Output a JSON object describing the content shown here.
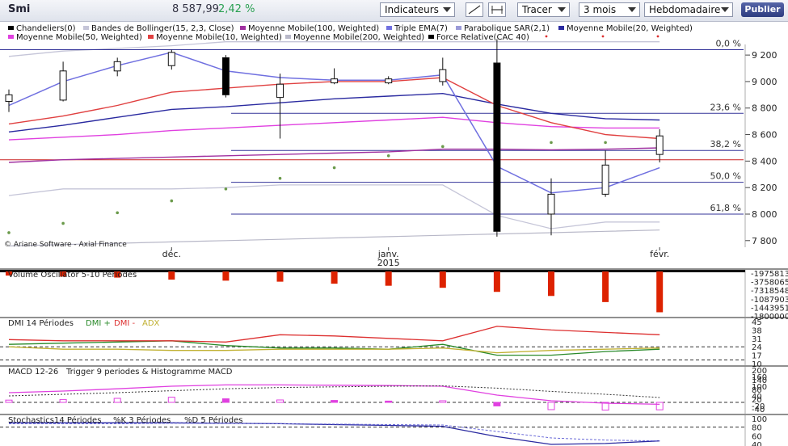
{
  "toolbar": {
    "symbol": "Smi",
    "price": "8 587,99",
    "change": "2,42 %",
    "indicators_label": "Indicateurs",
    "draw_label": "Tracer",
    "period_label": "3 mois",
    "interval_label": "Hebdomadaire",
    "publish_label": "Publier"
  },
  "colors": {
    "candle": "#000000",
    "bollinger": "#c5c5d8",
    "mm100": "#a030a0",
    "tema": "#7070e0",
    "sar": "#6a9a4a",
    "mm20": "#2a2aa0",
    "mm50": "#e040e0",
    "mm10": "#e04040",
    "mm200": "#b8b8c8",
    "force": "#000000",
    "volume": "#dd2200",
    "dmi_plus": "#2a8a2a",
    "dmi_minus": "#dd3030",
    "adx": "#c0b030",
    "macd": "#e040e0",
    "trigger": "#333333",
    "fib": "#333399",
    "hline": "#cc2222"
  },
  "legend": [
    {
      "label": "Chandeliers(0)",
      "color": "#000000"
    },
    {
      "label": "Bandes de Bollinger(15, 2,3, Close)",
      "color": "#c5c5d8"
    },
    {
      "label": "Moyenne Mobile(100, Weighted)",
      "color": "#a030a0"
    },
    {
      "label": "Triple EMA(7)",
      "color": "#7070e0"
    },
    {
      "label": "Parabolique SAR(2,1)",
      "color": "#9a9ad8"
    },
    {
      "label": "Moyenne Mobile(20, Weighted)",
      "color": "#2a2aa0"
    },
    {
      "label": "Moyenne Mobile(50, Weighted)",
      "color": "#e040e0"
    },
    {
      "label": "Moyenne Mobile(10, Weighted)",
      "color": "#e04040"
    },
    {
      "label": "Moyenne Mobile(200, Weighted)",
      "color": "#b8b8c8"
    },
    {
      "label": "Force Relative(CAC 40)",
      "color": "#000000"
    }
  ],
  "watermark": "© Ariane Software - Axial Finance",
  "chart_data": [
    {
      "type": "candlestick",
      "name": "price",
      "x_labels": [
        {
          "label": "déc.",
          "index": 3
        },
        {
          "label": "janv.",
          "sub": "2015",
          "index": 7
        },
        {
          "label": "févr.",
          "index": 12
        }
      ],
      "ylim": [
        7750,
        9280
      ],
      "yticks": [
        9200,
        9000,
        8800,
        8600,
        8400,
        8200,
        8000,
        7800
      ],
      "ytick_labels": [
        "9 200",
        "9 000",
        "8 800",
        "8 600",
        "8 400",
        "8 200",
        "8 000",
        "7 800"
      ],
      "candles": [
        {
          "o": 8850,
          "h": 8940,
          "l": 8770,
          "c": 8900
        },
        {
          "o": 8860,
          "h": 9150,
          "l": 8850,
          "c": 9080
        },
        {
          "o": 9080,
          "h": 9180,
          "l": 9040,
          "c": 9150
        },
        {
          "o": 9120,
          "h": 9240,
          "l": 9090,
          "c": 9220
        },
        {
          "o": 9180,
          "h": 9200,
          "l": 8880,
          "c": 8900
        },
        {
          "o": 8880,
          "h": 9060,
          "l": 8570,
          "c": 8980
        },
        {
          "o": 8990,
          "h": 9100,
          "l": 8980,
          "c": 9020
        },
        {
          "o": 8990,
          "h": 9040,
          "l": 8980,
          "c": 9020
        },
        {
          "o": 9000,
          "h": 9180,
          "l": 8970,
          "c": 9090
        },
        {
          "o": 9140,
          "h": 9320,
          "l": 7830,
          "c": 7870
        },
        {
          "o": 8000,
          "h": 8270,
          "l": 7840,
          "c": 8150
        },
        {
          "o": 8150,
          "h": 8480,
          "l": 8130,
          "c": 8370
        },
        {
          "o": 8450,
          "h": 8640,
          "l": 8390,
          "c": 8590
        }
      ],
      "series": [
        {
          "key": "boll_upper",
          "values": [
            9190,
            9230,
            9250,
            9270,
            9300,
            9300,
            9300,
            9300,
            9300,
            9300,
            9300,
            9300,
            9300
          ]
        },
        {
          "key": "boll_lower",
          "values": [
            8140,
            8190,
            8190,
            8190,
            8200,
            8220,
            8220,
            8220,
            8220,
            7990,
            7890,
            7940,
            7940
          ]
        },
        {
          "key": "mm10",
          "values": [
            8680,
            8740,
            8820,
            8920,
            8950,
            8980,
            9000,
            9000,
            9030,
            8820,
            8690,
            8600,
            8570
          ]
        },
        {
          "key": "mm20",
          "values": [
            8620,
            8670,
            8730,
            8790,
            8810,
            8840,
            8870,
            8890,
            8910,
            8830,
            8760,
            8720,
            8710
          ]
        },
        {
          "key": "mm50",
          "values": [
            8560,
            8580,
            8600,
            8630,
            8650,
            8670,
            8690,
            8710,
            8730,
            8690,
            8660,
            8650,
            8650
          ]
        },
        {
          "key": "mm100",
          "values": [
            8390,
            8410,
            8420,
            8430,
            8440,
            8450,
            8460,
            8470,
            8490,
            8490,
            8485,
            8490,
            8500
          ]
        },
        {
          "key": "mm200",
          "values": [
            7760,
            7770,
            7780,
            7790,
            7800,
            7810,
            7820,
            7830,
            7840,
            7850,
            7860,
            7870,
            7880
          ]
        },
        {
          "key": "tema",
          "values": [
            8820,
            9000,
            9120,
            9220,
            9080,
            9030,
            9010,
            9010,
            9050,
            8360,
            8160,
            8200,
            8350
          ]
        },
        {
          "key": "sar",
          "values": [
            7860,
            7930,
            8010,
            8100,
            8190,
            8270,
            8350,
            8440,
            8510,
            8540,
            8540,
            8540,
            8560
          ]
        }
      ],
      "hlines": [
        {
          "value": 8410,
          "color": "#cc2222"
        }
      ],
      "fib_levels": [
        {
          "label": "0,0 %",
          "value": 9240
        },
        {
          "label": "23,6 %",
          "value": 8760
        },
        {
          "label": "38,2 %",
          "value": 8480
        },
        {
          "label": "50,0 %",
          "value": 8240
        },
        {
          "label": "61,8 %",
          "value": 8000
        }
      ]
    },
    {
      "type": "bar",
      "name": "Volume Oscillator 5-10 Périodes",
      "values": [
        -4,
        -5,
        -6,
        -8,
        -9,
        -10,
        -12,
        -14,
        -16,
        -20,
        -24,
        -30,
        -40
      ],
      "ylim": [
        -42,
        0
      ],
      "ytick_labels": [
        "-1975813",
        "-3758065",
        "-7318548",
        "-1087903",
        "-1443951",
        "-1800000"
      ]
    },
    {
      "type": "line",
      "name": "DMI 14 Périodes",
      "legend": [
        "DMI +",
        "DMI -",
        "ADX"
      ],
      "series": [
        {
          "key": "dmi_plus",
          "values": [
            26,
            27,
            28,
            29,
            25,
            23,
            23,
            22,
            26,
            17,
            17,
            20,
            22
          ]
        },
        {
          "key": "dmi_minus",
          "values": [
            30,
            29,
            29,
            29,
            28,
            34,
            33,
            31,
            29,
            41,
            38,
            36,
            34
          ]
        },
        {
          "key": "adx",
          "values": [
            24,
            22,
            22,
            21,
            21,
            22,
            22,
            22,
            23,
            19,
            21,
            22,
            23
          ]
        }
      ],
      "ylim": [
        10,
        45
      ],
      "yticks": [
        45,
        38,
        31,
        24,
        17,
        10
      ],
      "dashed": [
        24,
        13
      ]
    },
    {
      "type": "bar+line",
      "name": "MACD 12-26",
      "legend": [
        "Trigger 9 periodes & Histogramme MACD"
      ],
      "histogram": [
        14,
        18,
        25,
        32,
        22,
        15,
        12,
        8,
        10,
        -22,
        -45,
        -48,
        -46
      ],
      "macd": [
        60,
        70,
        84,
        100,
        108,
        108,
        106,
        104,
        100,
        45,
        10,
        -5,
        -12
      ],
      "trigger": [
        40,
        50,
        60,
        72,
        84,
        92,
        96,
        100,
        102,
        88,
        68,
        50,
        30
      ],
      "ylim": [
        -60,
        200
      ],
      "yticks": [
        200,
        140,
        80,
        20,
        -40
      ],
      "ytick_labels": [
        "200",
        "140",
        "80",
        "20",
        "-40"
      ],
      "mid_labels": [
        "160",
        "100",
        "40",
        "-20"
      ],
      "zero_line": 0
    },
    {
      "type": "line",
      "name": "Stochastics14 Périodes",
      "legend": [
        "%K 3 Périodes",
        "%D 5 Périodes"
      ],
      "k": [
        90,
        90,
        90,
        90,
        89,
        88,
        86,
        84,
        82,
        58,
        40,
        42,
        48
      ],
      "d": [
        88,
        88,
        88,
        89,
        89,
        88,
        87,
        86,
        85,
        70,
        55,
        50,
        48
      ],
      "ylim": [
        40,
        100
      ],
      "yticks": [
        100,
        80,
        60,
        40
      ],
      "dashed": [
        80
      ]
    }
  ]
}
